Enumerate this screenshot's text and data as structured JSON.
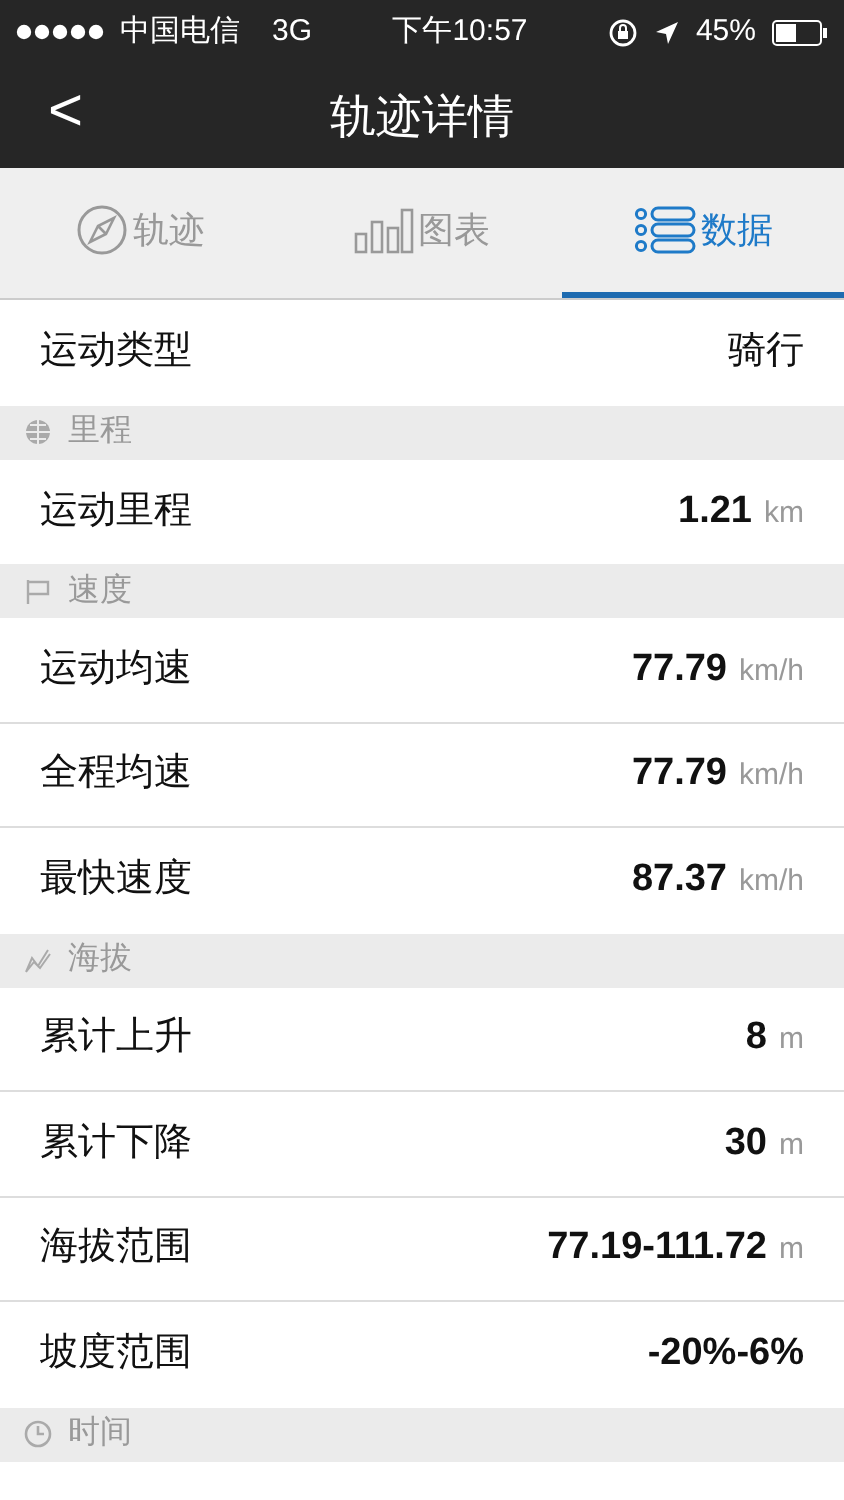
{
  "status_bar": {
    "carrier": "中国电信",
    "network": "3G",
    "time": "下午10:57",
    "battery": "45%"
  },
  "nav": {
    "back": "<",
    "title": "轨迹详情"
  },
  "tabs": [
    {
      "label": "轨迹",
      "selected": false
    },
    {
      "label": "图表",
      "selected": false
    },
    {
      "label": "数据",
      "selected": true
    }
  ],
  "items": [
    {
      "kind": "row",
      "label": "运动类型",
      "value": "骑行",
      "bold": false
    },
    {
      "kind": "header",
      "title": "里程"
    },
    {
      "kind": "row",
      "label": "运动里程",
      "value": "1.21",
      "unit": "km",
      "bold": true
    },
    {
      "kind": "header",
      "title": "速度"
    },
    {
      "kind": "row",
      "label": "运动均速",
      "value": "77.79",
      "unit": "km/h",
      "bold": true
    },
    {
      "kind": "row",
      "label": "全程均速",
      "value": "77.79",
      "unit": "km/h",
      "bold": true
    },
    {
      "kind": "row",
      "label": "最快速度",
      "value": "87.37",
      "unit": "km/h",
      "bold": true
    },
    {
      "kind": "header",
      "title": "海拔"
    },
    {
      "kind": "row",
      "label": "累计上升",
      "value": "8",
      "unit": "m",
      "bold": true
    },
    {
      "kind": "row",
      "label": "累计下降",
      "value": "30",
      "unit": "m",
      "bold": true
    },
    {
      "kind": "row",
      "label": "海拔范围",
      "value": "77.19-111.72",
      "unit": "m",
      "bold": true
    },
    {
      "kind": "row",
      "label": "坡度范围",
      "value": "-20%-6%",
      "bold": true
    },
    {
      "kind": "header",
      "title": "时间"
    }
  ]
}
